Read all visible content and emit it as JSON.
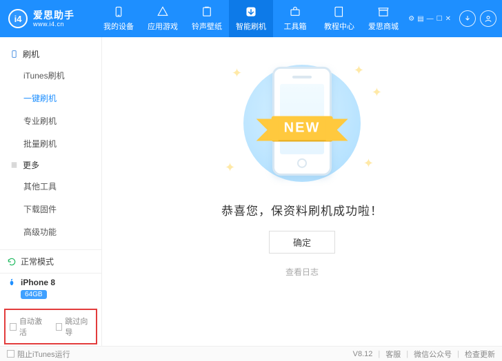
{
  "header": {
    "logo_badge": "i4",
    "title": "爱思助手",
    "site": "www.i4.cn",
    "tabs": [
      {
        "label": "我的设备"
      },
      {
        "label": "应用游戏"
      },
      {
        "label": "铃声壁纸"
      },
      {
        "label": "智能刷机"
      },
      {
        "label": "工具箱"
      },
      {
        "label": "教程中心"
      },
      {
        "label": "爱思商城"
      }
    ]
  },
  "sidebar": {
    "group1_title": "刷机",
    "items1": [
      {
        "label": "iTunes刷机"
      },
      {
        "label": "一键刷机"
      },
      {
        "label": "专业刷机"
      },
      {
        "label": "批量刷机"
      }
    ],
    "group2_title": "更多",
    "items2": [
      {
        "label": "其他工具"
      },
      {
        "label": "下载固件"
      },
      {
        "label": "高级功能"
      }
    ],
    "mode": "正常模式",
    "device_name": "iPhone 8",
    "device_capacity": "64GB",
    "auto_activate": "自动激活",
    "skip_wizard": "跳过向导"
  },
  "main": {
    "ribbon": "NEW",
    "message": "恭喜您，保资料刷机成功啦！",
    "ok": "确定",
    "view_log": "查看日志"
  },
  "footer": {
    "block_itunes": "阻止iTunes运行",
    "version": "V8.12",
    "support": "客服",
    "wechat": "微信公众号",
    "update": "检查更新"
  }
}
